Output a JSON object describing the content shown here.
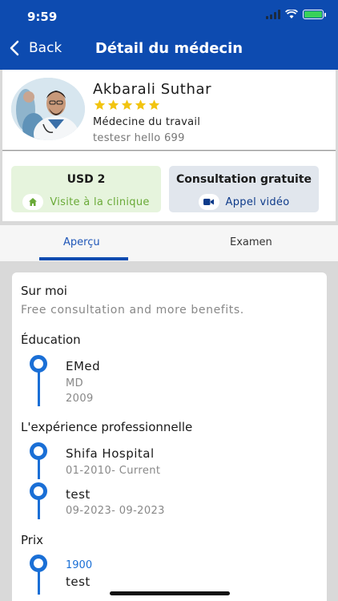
{
  "status_bar": {
    "time": "9:59"
  },
  "header": {
    "back_label": "Back",
    "title": "Détail du médecin"
  },
  "doctor": {
    "name": "Akbarali Suthar",
    "rating": 5,
    "specialty": "Médecine du travail",
    "subline": "testesr hello 699"
  },
  "options": {
    "clinic": {
      "price": "USD 2",
      "label": "Visite à la clinique",
      "icon": "home-icon"
    },
    "video": {
      "price": "Consultation gratuite",
      "label": "Appel vidéo",
      "icon": "video-camera-icon"
    }
  },
  "tabs": [
    {
      "label": "Aperçu",
      "active": true
    },
    {
      "label": "Examen",
      "active": false
    }
  ],
  "overview": {
    "about_heading": "Sur moi",
    "about_text": "Free consultation and more benefits.",
    "education_heading": "Éducation",
    "education": [
      {
        "school": "EMed",
        "degree": "MD",
        "year": "2009"
      }
    ],
    "experience_heading": "L'expérience professionnelle",
    "experience": [
      {
        "place": "Shifa Hospital",
        "period": "01-2010- Current"
      },
      {
        "place": "test",
        "period": "09-2023- 09-2023"
      }
    ],
    "price_heading": "Prix",
    "prices": [
      {
        "amount": "1900",
        "label": "test"
      }
    ]
  },
  "colors": {
    "header_blue": "#0d4bb0",
    "star_yellow": "#f2c40f",
    "clinic_green": "#6aaa38",
    "timeline_blue": "#1a6fd6"
  }
}
